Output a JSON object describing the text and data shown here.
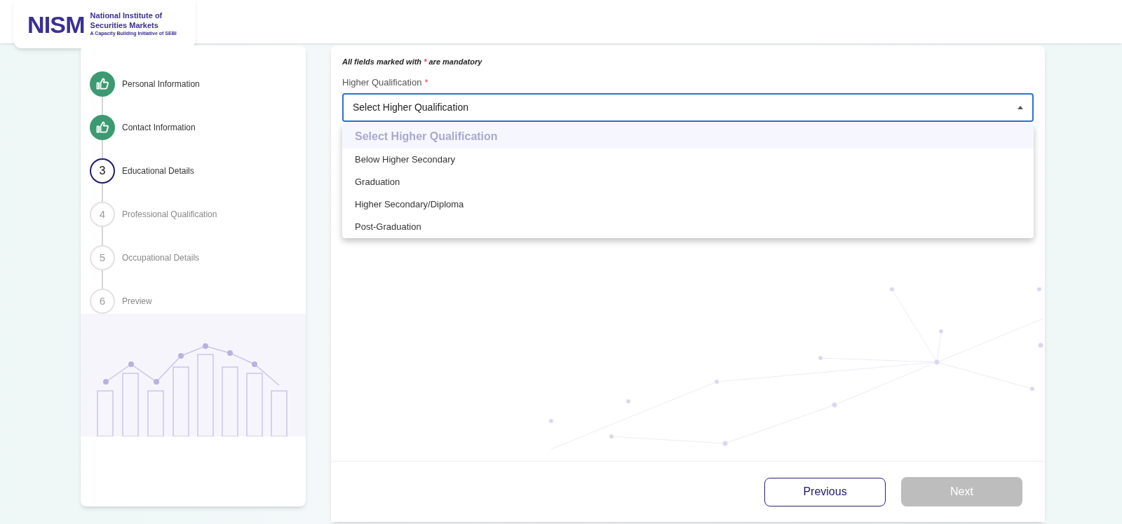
{
  "logo": {
    "mark": "NISM",
    "name_line_1": "National Institute of",
    "name_line_2": "Securities Markets",
    "tagline": "A Capacity Building Initiative of SEBI"
  },
  "steps": [
    {
      "label": "Personal Information",
      "kind": "done"
    },
    {
      "label": "Contact Information",
      "kind": "done"
    },
    {
      "number": "3",
      "label": "Educational Details",
      "kind": "current"
    },
    {
      "number": "4",
      "label": "Professional Qualification",
      "kind": "pending"
    },
    {
      "number": "5",
      "label": "Occupational Details",
      "kind": "pending"
    },
    {
      "number": "6",
      "label": "Preview",
      "kind": "pending"
    }
  ],
  "form": {
    "note_before": "All fields marked with",
    "note_mark": "*",
    "note_after": "are mandatory",
    "field": {
      "label": "Higher Qualification",
      "required_mark": "*",
      "value": "Select Higher Qualification",
      "expanded": true,
      "options": [
        {
          "label": "Select Higher Qualification",
          "selected": true
        },
        {
          "label": "Below Higher Secondary",
          "selected": false
        },
        {
          "label": "Graduation",
          "selected": false
        },
        {
          "label": "Higher Secondary/Diploma",
          "selected": false
        },
        {
          "label": "Post-Graduation",
          "selected": false
        }
      ]
    }
  },
  "buttons": [
    {
      "label": "Previous",
      "disabled": false
    },
    {
      "label": "Next",
      "disabled": true
    }
  ]
}
